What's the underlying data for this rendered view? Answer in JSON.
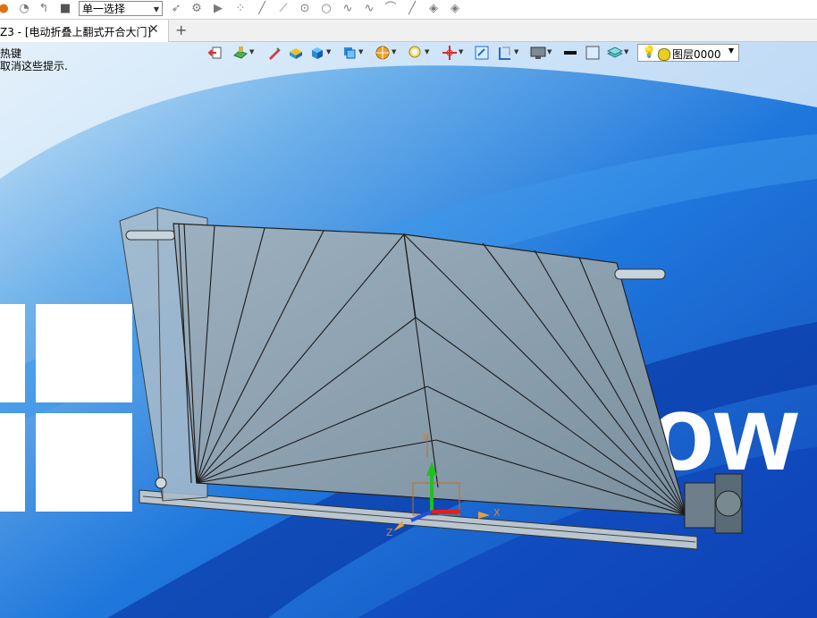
{
  "toolbar": {
    "select_mode": "单一选择",
    "icons": [
      "history-icon",
      "reset-icon",
      "stop-icon",
      "filter-icon",
      "pick-icon",
      "play-icon",
      "point-icon",
      "line-icon",
      "slash-icon",
      "target-icon",
      "circle-icon",
      "curve-icon",
      "arc-icon",
      "pen-icon",
      "tool1-icon",
      "tool2-icon"
    ]
  },
  "tab": {
    "title": "Z3 - [电动折叠上翻式开合大门]",
    "close": "✕",
    "add": "+"
  },
  "hint": {
    "line1": "热键",
    "line2": "取消这些提示."
  },
  "view_toolbar": {
    "layer_name": "图层0000"
  },
  "background": {
    "logo_text": "ow"
  },
  "axes": {
    "x_label": "X",
    "y_label": "Y",
    "z_label": "Z"
  },
  "colors": {
    "panel_fill": "#8fa4b4",
    "background_blue": "#1e6fd6",
    "axis_x": "#e02020",
    "axis_y": "#20c020",
    "axis_z": "#2050e0"
  }
}
